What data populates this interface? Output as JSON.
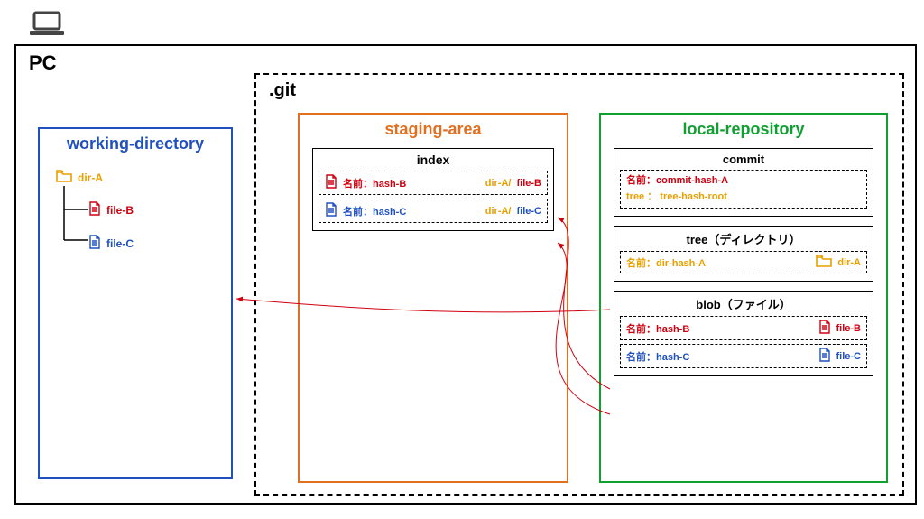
{
  "pc_label": "PC",
  "git_label": ".git",
  "working_directory": {
    "title": "working-directory",
    "dir_a": "dir-A",
    "file_b": "file-B",
    "file_c": "file-C"
  },
  "staging_area": {
    "title": "staging-area",
    "index_title": "index",
    "row_b": {
      "name_label": "名前：hash-B",
      "path_dir": "dir-A/",
      "path_file": "file-B"
    },
    "row_c": {
      "name_label": "名前：hash-C",
      "path_dir": "dir-A/",
      "path_file": "file-C"
    }
  },
  "local_repository": {
    "title": "local-repository",
    "commit": {
      "title": "commit",
      "name_label": "名前：commit-hash-A",
      "tree_label": "tree ： tree-hash-root"
    },
    "tree": {
      "title": "tree（ディレクトリ）",
      "name_label": "名前：dir-hash-A",
      "dir_label": "dir-A"
    },
    "blob": {
      "title": "blob（ファイル）",
      "row_b": {
        "name_label": "名前：hash-B",
        "file": "file-B"
      },
      "row_c": {
        "name_label": "名前：hash-C",
        "file": "file-C"
      }
    }
  },
  "colors": {
    "red": "#d00010",
    "blue": "#2050c0",
    "orange": "#e8a000",
    "green": "#10a030",
    "staging_border": "#e07020"
  }
}
